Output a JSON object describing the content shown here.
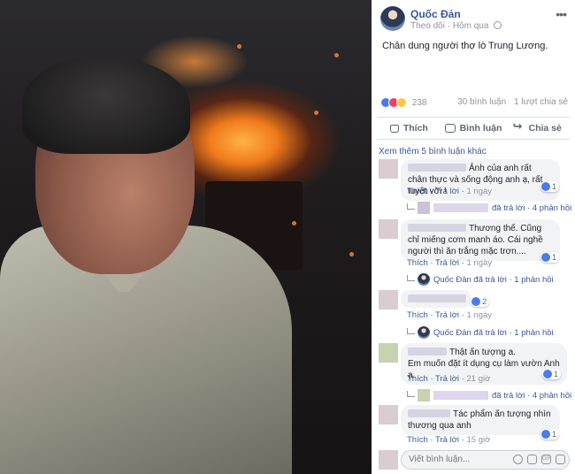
{
  "post": {
    "author": "Quốc Đản",
    "follow": "Theo dõi",
    "time": "Hôm qua",
    "caption": "Chân dung người thợ lò Trung Lương.",
    "reaction_count": "238",
    "comments_count": "30 bình luận",
    "shares_count": "1 lượt chia sẻ"
  },
  "actions": {
    "like": "Thích",
    "comment": "Bình luận",
    "share": "Chia sẻ"
  },
  "see_more": "Xem thêm 5 bình luận khác",
  "comments": [
    {
      "text": "Ảnh của anh rất chân thực và sống động anh ạ, rất tuyệt vời !",
      "likes": "1",
      "like": "Thích",
      "reply": "Trả lời",
      "time": "1 ngày",
      "reply_info": {
        "who": "",
        "action": "đã trả lời",
        "count": "4 phản hồi"
      }
    },
    {
      "text": "Thương thế. Cũng chỉ miếng cơm manh áo. Cái nghề người thì ăn trắng mặc trơn....",
      "likes": "1",
      "like": "Thích",
      "reply": "Trả lời",
      "time": "1 ngày",
      "reply_info": {
        "who": "Quốc Đản",
        "action": "đã trả lời",
        "count": "1 phản hồi"
      }
    },
    {
      "text": "",
      "likes": "2",
      "like": "Thích",
      "reply": "Trả lời",
      "time": "1 ngày",
      "reply_info": {
        "who": "Quốc Đản",
        "action": "đã trả lời",
        "count": "1 phản hồi"
      }
    },
    {
      "text_line1": "Thật ấn tượng a.",
      "text_line2": "Em muốn đặt ít dụng cụ làm vườn Anh ạ.",
      "likes": "1",
      "like": "Thích",
      "reply": "Trả lời",
      "time": "21 giờ",
      "reply_info": {
        "who": "",
        "action": "đã trả lời",
        "count": "4 phản hồi"
      }
    },
    {
      "text": "Tác phẩm ấn tượng nhìn thương qua anh",
      "likes": "1",
      "like": "Thích",
      "reply": "Trả lời",
      "time": "15 giờ"
    }
  ],
  "compose": {
    "placeholder": "Viết bình luận..."
  },
  "colors": {
    "link": "#385898",
    "muted": "#90949c",
    "bubble": "#f2f3f5"
  }
}
